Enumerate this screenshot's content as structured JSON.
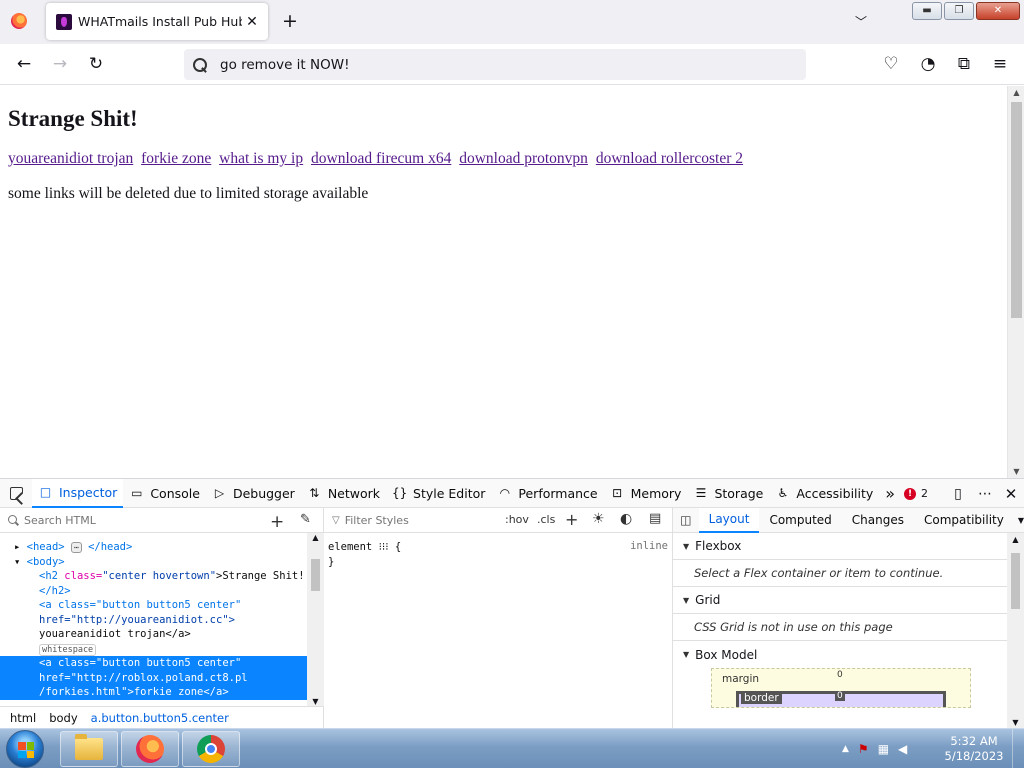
{
  "browser": {
    "tab_title": "WHATmails Install Pub Hub",
    "tab_close": "✕",
    "new_tab": "+",
    "tab_list": "﹀",
    "url_value": "go remove it NOW!",
    "window_controls": {
      "minimize": "▬",
      "restore": "❐",
      "close": "✕"
    }
  },
  "nav": {
    "back": "←",
    "forward": "→",
    "reload": "↻",
    "pocket": "♡",
    "account": "◔",
    "extensions": "⧉",
    "menu": "≡"
  },
  "page": {
    "heading": "Strange Shit!",
    "links": [
      "youareanidiot trojan",
      "forkie zone",
      "what is my ip",
      "download firecum x64",
      "download protonvpn",
      "download rollercoster 2"
    ],
    "note": "some links will be deleted due to limited storage available"
  },
  "devtools": {
    "tabs": [
      {
        "label": "Inspector",
        "icon": "□"
      },
      {
        "label": "Console",
        "icon": "▭"
      },
      {
        "label": "Debugger",
        "icon": "▷"
      },
      {
        "label": "Network",
        "icon": "⇅"
      },
      {
        "label": "Style Editor",
        "icon": "{}"
      },
      {
        "label": "Performance",
        "icon": "◠"
      },
      {
        "label": "Memory",
        "icon": "⊡"
      },
      {
        "label": "Storage",
        "icon": "☰"
      },
      {
        "label": "Accessibility",
        "icon": "♿"
      }
    ],
    "overflow": "»",
    "error_count": "2",
    "error_icon": "!",
    "search_placeholder": "Search HTML",
    "tree": {
      "head_tag": "<head>",
      "head_close": "</head>",
      "body_tag": "<body>",
      "h2_open": "<h2 ",
      "h2_attr": "class=",
      "h2_val": "\"center hovertown\"",
      "h2_text": ">Strange Shit!",
      "h2_close": "</h2>",
      "a1_line1": "<a class=\"button button5 center\"",
      "a1_line2": "href=\"http://youareanidiot.cc\">",
      "a1_line3": "youareanidiot trojan</a>",
      "whitespace": "whitespace",
      "a2_line1": "<a class=\"button button5 center\"",
      "a2_line2": "href=\"http://roblox.poland.ct8.pl",
      "a2_line3": "/forkies.html\">forkie zone</a>"
    },
    "breadcrumbs": [
      "html",
      "body",
      "a.button.button5.center"
    ],
    "rules": {
      "filter_placeholder": "Filter Styles",
      "hov": ":hov",
      "cls": ".cls",
      "rule_line1": "element ⁝⁝⁝ {",
      "rule_line2": "}",
      "source": "inline"
    },
    "sidebar": {
      "tabs": [
        "Layout",
        "Computed",
        "Changes",
        "Compatibility"
      ],
      "flexbox_title": "Flexbox",
      "flexbox_msg": "Select a Flex container or item to continue.",
      "grid_title": "Grid",
      "grid_msg": "CSS Grid is not in use on this page",
      "boxmodel_title": "Box Model",
      "margin_label": "margin",
      "border_label": "border",
      "zero": "0"
    }
  },
  "taskbar": {
    "time": "5:32 AM",
    "date": "5/18/2023",
    "tray_arrow": "▲"
  }
}
